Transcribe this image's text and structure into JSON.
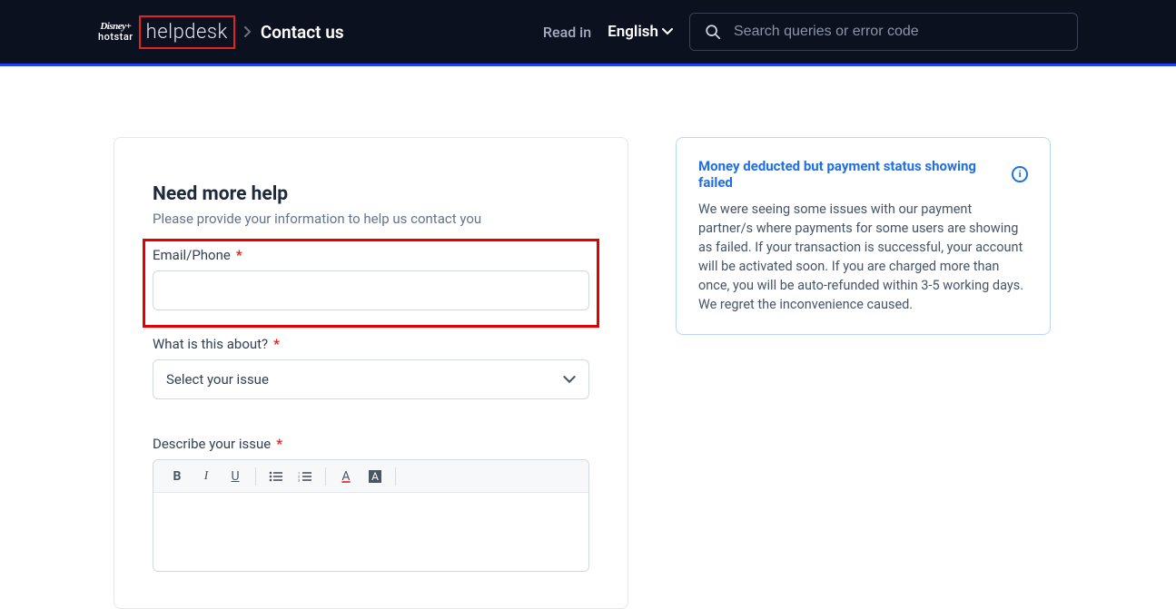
{
  "header": {
    "logo_top": "Disney+",
    "logo_bottom": "hotstar",
    "helpdesk": "helpdesk",
    "breadcrumb_current": "Contact us",
    "read_in": "Read in",
    "language": "English",
    "search_placeholder": "Search queries or error code"
  },
  "form": {
    "title": "Need more help",
    "subtitle": "Please provide your information to help us contact you",
    "email_label": "Email/Phone",
    "about_label": "What is this about?",
    "about_placeholder": "Select your issue",
    "describe_label": "Describe your issue"
  },
  "info": {
    "title": "Money deducted but payment status showing failed",
    "body": "We were seeing some issues with our payment partner/s where payments for some users are showing as failed. If your transaction is successful, your account will be activated soon. If you are charged more than once, you will be auto-refunded within 3-5 working days. We regret the inconvenience caused."
  }
}
